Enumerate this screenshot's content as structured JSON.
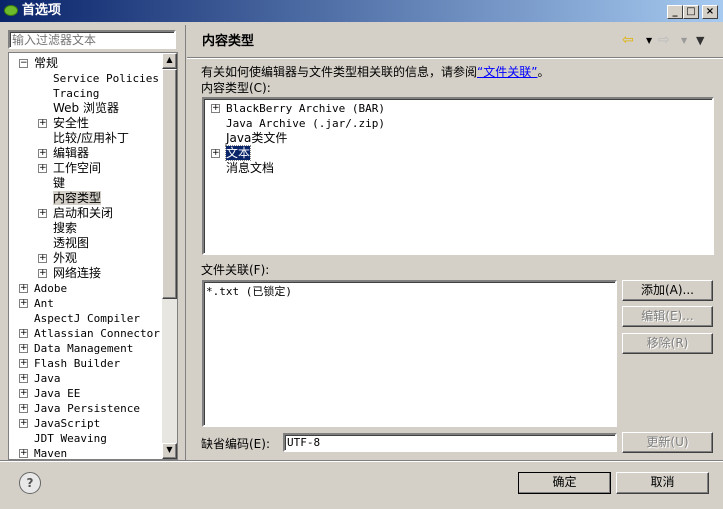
{
  "window": {
    "title": "首选项",
    "min": "_",
    "max": "□",
    "close": "×"
  },
  "filter": {
    "placeholder": "输入过滤器文本"
  },
  "nav_tree": [
    {
      "label": "常规",
      "level": 0,
      "exp": "−"
    },
    {
      "label": "Service Policies",
      "level": 1,
      "mono": true
    },
    {
      "label": "Tracing",
      "level": 1,
      "mono": true
    },
    {
      "label": "Web 浏览器",
      "level": 1
    },
    {
      "label": "安全性",
      "level": 1,
      "exp": "+"
    },
    {
      "label": "比较/应用补丁",
      "level": 1
    },
    {
      "label": "编辑器",
      "level": 1,
      "exp": "+"
    },
    {
      "label": "工作空间",
      "level": 1,
      "exp": "+"
    },
    {
      "label": "键",
      "level": 1
    },
    {
      "label": "内容类型",
      "level": 1,
      "selected": true
    },
    {
      "label": "启动和关闭",
      "level": 1,
      "exp": "+"
    },
    {
      "label": "搜索",
      "level": 1
    },
    {
      "label": "透视图",
      "level": 1
    },
    {
      "label": "外观",
      "level": 1,
      "exp": "+"
    },
    {
      "label": "网络连接",
      "level": 1,
      "exp": "+"
    },
    {
      "label": "Adobe",
      "level": 0,
      "exp": "+",
      "mono": true
    },
    {
      "label": "Ant",
      "level": 0,
      "exp": "+",
      "mono": true
    },
    {
      "label": "AspectJ Compiler",
      "level": 0,
      "mono": true
    },
    {
      "label": "Atlassian Connector",
      "level": 0,
      "exp": "+",
      "mono": true
    },
    {
      "label": "Data Management",
      "level": 0,
      "exp": "+",
      "mono": true
    },
    {
      "label": "Flash Builder",
      "level": 0,
      "exp": "+",
      "mono": true
    },
    {
      "label": "Java",
      "level": 0,
      "exp": "+",
      "mono": true
    },
    {
      "label": "Java EE",
      "level": 0,
      "exp": "+",
      "mono": true
    },
    {
      "label": "Java Persistence",
      "level": 0,
      "exp": "+",
      "mono": true
    },
    {
      "label": "JavaScript",
      "level": 0,
      "exp": "+",
      "mono": true
    },
    {
      "label": "JDT Weaving",
      "level": 0,
      "mono": true
    },
    {
      "label": "Maven",
      "level": 0,
      "exp": "+",
      "mono": true
    }
  ],
  "page": {
    "title": "内容类型",
    "desc_prefix": "有关如何使编辑器与文件类型相关联的信息，请参阅",
    "desc_link": "“文件关联”",
    "desc_suffix": "。",
    "content_types_label": "内容类型(C):",
    "content_types": [
      {
        "label": "BlackBerry Archive (BAR)",
        "exp": "+",
        "mono": true
      },
      {
        "label": "Java Archive (.jar/.zip)",
        "mono": true
      },
      {
        "label": "Java类文件"
      },
      {
        "label": "文本",
        "exp": "+",
        "selected": true
      },
      {
        "label": "消息文档"
      }
    ],
    "file_assoc_label": "文件关联(F):",
    "file_assoc": [
      "*.txt (已锁定)"
    ],
    "add": "添加(A)...",
    "edit": "编辑(E)...",
    "remove": "移除(R)",
    "encoding_label": "缺省编码(E):",
    "encoding_value": "UTF-8",
    "update": "更新(U)"
  },
  "footer": {
    "ok": "确定",
    "cancel": "取消",
    "help": "?"
  }
}
